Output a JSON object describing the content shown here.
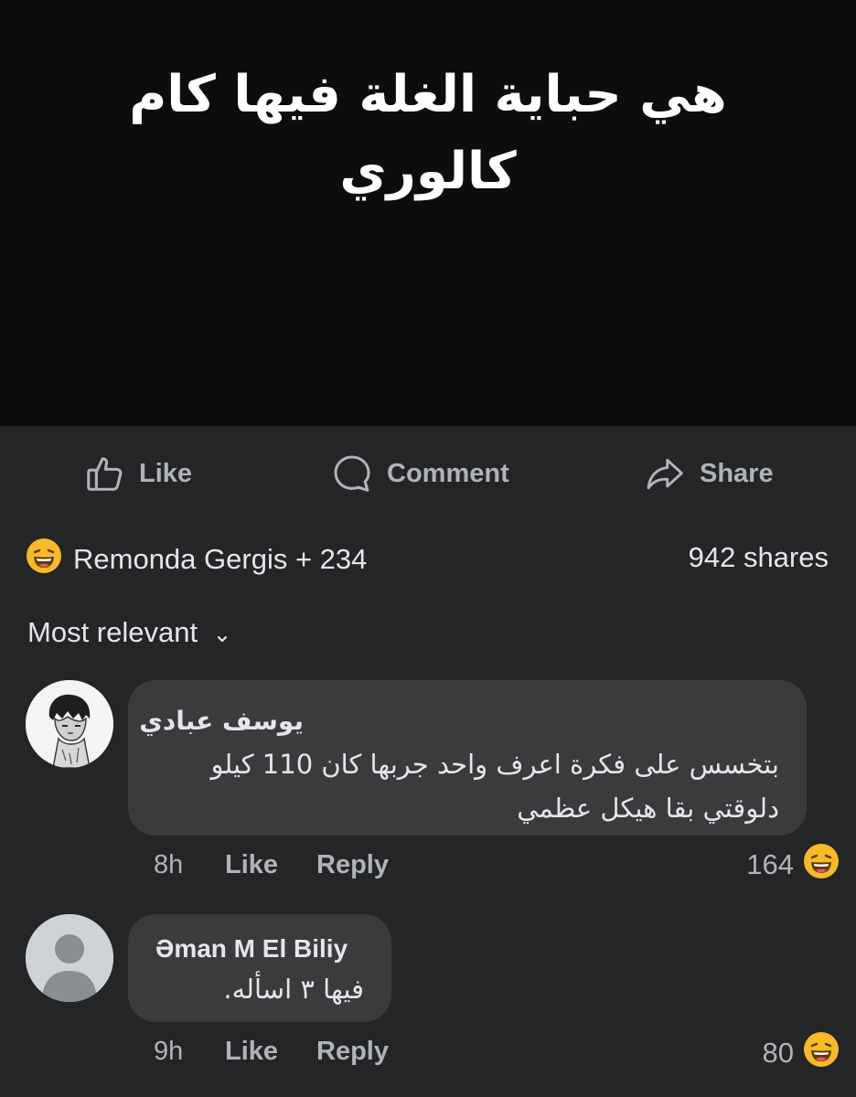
{
  "post": {
    "text_line1": "هي حباية الغلة فيها كام",
    "text_line2": "كالوري"
  },
  "actions": {
    "like": "Like",
    "comment": "Comment",
    "share": "Share"
  },
  "reactions": {
    "summary": "Remonda Gergis + 234",
    "shares": "942 shares",
    "icon": "laughing-emoji-icon"
  },
  "sort": {
    "label": "Most relevant"
  },
  "comments": [
    {
      "author": "يوسف عبادي",
      "text_line1": "بتخسس على فكرة اعرف واحد جربها كان 110 كيلو",
      "text_line2": "دلوقتي بقا هيكل عظمي",
      "time": "8h",
      "like": "Like",
      "reply": "Reply",
      "reaction_count": "164"
    },
    {
      "author": "Əman M El Biliy",
      "text_line1": "فيها ٣ اسأله.",
      "time": "9h",
      "like": "Like",
      "reply": "Reply",
      "reaction_count": "80"
    }
  ],
  "colors": {
    "background": "#242526",
    "post_background": "#0d0d0d",
    "bubble": "#3a3b3c",
    "primary_text": "#e4e6eb",
    "secondary_text": "#b0b3b8",
    "emoji": "#f7b928"
  }
}
